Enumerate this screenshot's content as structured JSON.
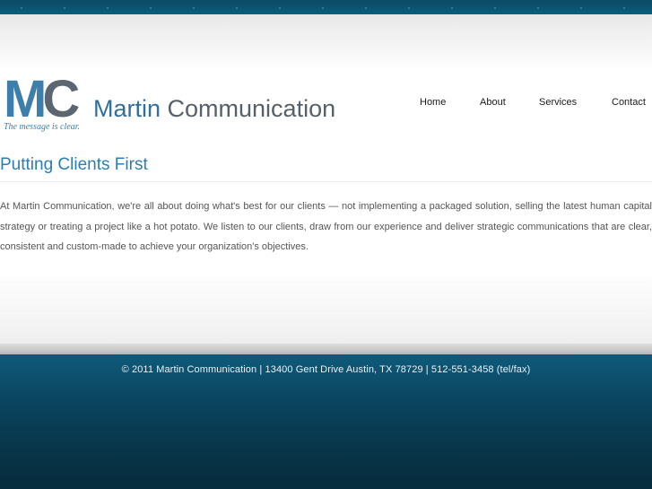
{
  "logo": {
    "mark_m": "M",
    "mark_c": "C",
    "name_first": "Martin",
    "name_last": "Communication",
    "tagline": "The message is clear."
  },
  "nav": {
    "items": [
      {
        "label": "Home"
      },
      {
        "label": "About"
      },
      {
        "label": "Services"
      },
      {
        "label": "Contact"
      }
    ]
  },
  "main": {
    "title": "Putting Clients First",
    "intro": "At Martin Communication, we're all about doing what's best for our clients — not implementing a packaged solution, selling the latest human capital strategy or treating a project like a hot potato. We listen to our clients, draw from our experience and deliver strategic communications that are clear, consistent and custom-made to achieve your organization's objectives."
  },
  "footer": {
    "text": "© 2011 Martin Communication | 13400 Gent Drive Austin, TX 78729 | 512-551-3458 (tel/fax)"
  },
  "colors": {
    "brand_blue": "#2a7db5",
    "brand_gray": "#56606a",
    "footer_bg": "#0a4560"
  }
}
